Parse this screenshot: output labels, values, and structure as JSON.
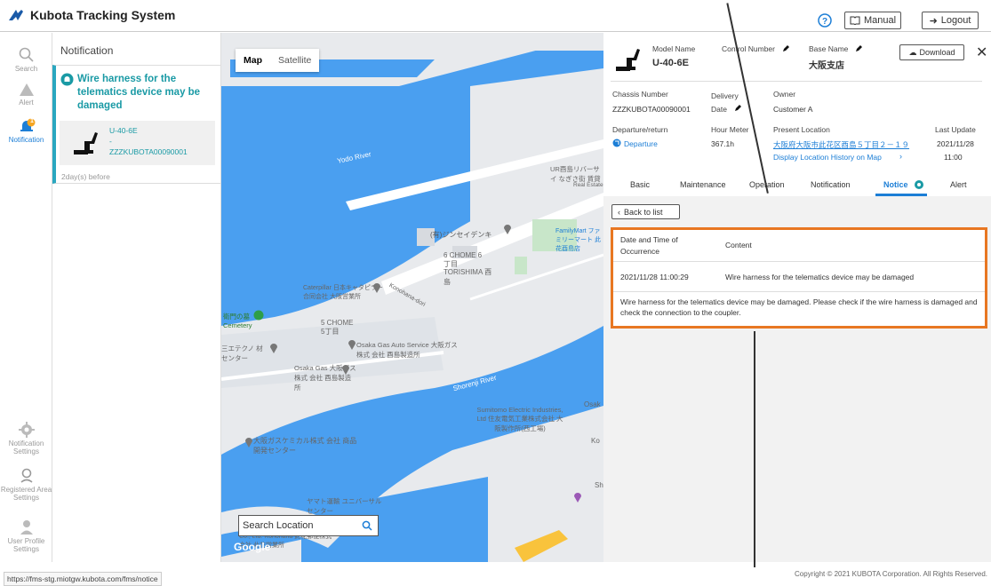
{
  "app": {
    "title": "Kubota Tracking System",
    "manual_label": "Manual",
    "logout_label": "Logout",
    "help_icon": "question-circle-icon"
  },
  "rail": {
    "search": "Search",
    "alert": "Alert",
    "notification": "Notification",
    "notification_badge": "1",
    "notification_settings": "Notification Settings",
    "registered_area": "Registered Area Settings",
    "user_profile": "User Profile Settings"
  },
  "list": {
    "header": "Notification",
    "item": {
      "title": "Wire harness for the telematics device may be damaged",
      "model": "U-40-6E",
      "dash": "-",
      "chassis": "ZZZKUBOTA00090001",
      "time": "2day(s) before"
    }
  },
  "map": {
    "tab_map": "Map",
    "tab_satellite": "Satellite",
    "search_placeholder": "Search Location",
    "google": "Google",
    "labels": [
      "Yodo River",
      "Shorenji River",
      "(有)ジンセイデンキ",
      "6 CHOME 6丁目",
      "TORISHIMA 酉島",
      "Caterpillar 日本キャタピラー 合同会社 大阪営業所",
      "5 CHOME 5丁目",
      "Osaka Gas Auto Service 大阪ガス株式 会社 酉島製造所",
      "Osaka Gas 大阪ガス株式 会社 酉島製造所",
      "Sumitomo Electric Industries, Ltd 住友電気工業株式会社 大阪製作所(西工場)",
      "大阪ガスケミカル株式 会社 商品開発センター",
      "ヤマト運輸 ユニバーサルセンター",
      "FamilyMart ファミリーマート 此花酉島店",
      "UR酉島リバーサイ なぎさ街 賃貸",
      "衛門の墓 Cemetery",
      "三エテクノ 材センター",
      "Co., Ltd. Konohana 此花郵便株式 会社 此花営業所",
      "Konohana-dori",
      "Osak",
      "Ko",
      "Sh",
      "Real Estate"
    ]
  },
  "panel": {
    "model_name_label": "Model Name",
    "model_name": "U-40-6E",
    "control_number_label": "Control Number",
    "base_name_label": "Base Name",
    "base_name": "大阪支店",
    "download_label": "Download",
    "chassis_label": "Chassis Number",
    "chassis": "ZZZKUBOTA00090001",
    "delivery_label": "Delivery Date",
    "owner_label": "Owner",
    "owner": "Customer A",
    "departure_label": "Departure/return",
    "departure": "Departure",
    "hour_label": "Hour Meter",
    "hour": "367.1h",
    "location_label": "Present Location",
    "location": "大阪府大阪市此花区酉島５丁目２－１９",
    "history": "Display Location History on Map",
    "last_update_label": "Last Update",
    "last_update_date": "2021/11/28",
    "last_update_time": "11:00",
    "tabs": [
      "Basic",
      "Maintenance",
      "Operation",
      "Notification",
      "Notice",
      "Alert"
    ],
    "back": "Back to list",
    "col_time": "Date and Time of Occurrence",
    "col_content": "Content",
    "row_time": "2021/11/28 11:00:29",
    "row_content": "Wire harness for the telematics device may be damaged",
    "detail": "Wire harness for the telematics device may be damaged. Please check if the wire harness is damaged and check the connection to the coupler."
  },
  "status": {
    "url": "https://fms-stg.miotgw.kubota.com/fms/notice",
    "copyright": "Copyright © 2021 KUBOTA Corporation. All Rights Reserved."
  },
  "colors": {
    "accent": "#1a9aa5",
    "highlight": "#e87722",
    "link": "#1c7ed6",
    "water": "#4a9ff0"
  }
}
